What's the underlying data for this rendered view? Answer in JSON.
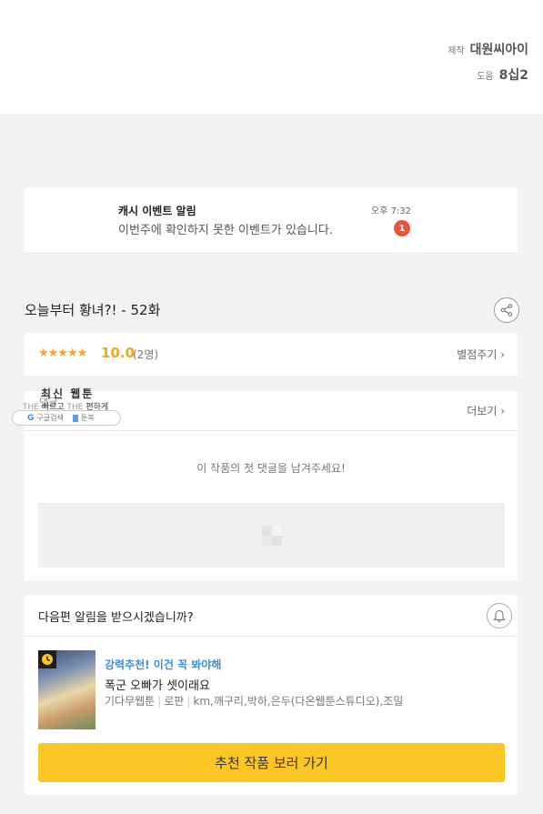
{
  "credits": {
    "production_label": "제작",
    "production_value": "대원씨아이",
    "assist_label": "도움",
    "assist_value": "8십2"
  },
  "event": {
    "title": "캐시 이벤트 알림",
    "description": "이번주에 확인하지 못한 이벤트가 있습니다.",
    "time": "오후 7:32",
    "badge_count": "1"
  },
  "episode": {
    "title": "오늘부터 황녀?! - 52화"
  },
  "rating": {
    "stars": "★★★★★",
    "score": "10.0",
    "raters": "(2명)",
    "rate_link": "별점주기 ›"
  },
  "comments": {
    "more_link": "더보기 ›",
    "empty_message": "이 작품의 첫 댓글을 남겨주세요!",
    "faded_heading": "댓글"
  },
  "overlay": {
    "title": "최신 웹툰",
    "sub_the1": "THE",
    "sub_text1": "빠르고",
    "sub_the2": "THE",
    "sub_text2": "편하게",
    "search_label": "구글검색",
    "toonbook_label": "툰북"
  },
  "notify": {
    "question": "다음편 알림을 받으시겠습니까?",
    "recommend_tag": "강력추천! 이건 꼭 봐야해",
    "recommend_title": "폭군 오빠가 셋이래요",
    "meta_type": "기다무웹툰",
    "meta_genre": "로판",
    "meta_authors": "km,깨구리,박하,은두(다온웹툰스튜디오),조밀",
    "button_label": "추천 작품 보러 가기"
  },
  "colors": {
    "accent_yellow": "#fcc625",
    "star_orange": "#f5a623",
    "badge_red": "#e8553a",
    "link_blue": "#3b8fdd"
  }
}
